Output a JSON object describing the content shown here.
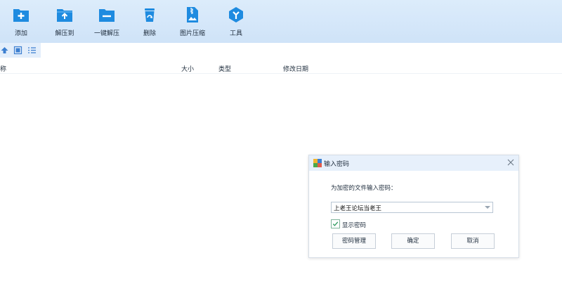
{
  "toolbar": {
    "items": [
      {
        "label": "添加",
        "icon": "add-folder-icon"
      },
      {
        "label": "解压到",
        "icon": "extract-to-icon"
      },
      {
        "label": "一键解压",
        "icon": "one-click-extract-icon"
      },
      {
        "label": "删除",
        "icon": "recycle-bin-icon"
      },
      {
        "label": "图片压缩",
        "icon": "image-compress-icon"
      },
      {
        "label": "工具",
        "icon": "tools-icon"
      }
    ]
  },
  "nav": {
    "icons": [
      "up-icon",
      "view-icon",
      "list-icon"
    ],
    "path": ""
  },
  "columns": {
    "name": "称",
    "size": "大小",
    "type": "类型",
    "modified": "修改日期"
  },
  "dialog": {
    "title": "输入密码",
    "prompt": "为加密的文件输入密码：",
    "password_value": "上老王论坛当老王",
    "show_password_label": "显示密码",
    "show_password_checked": true,
    "buttons": {
      "manage": "密码管理",
      "ok": "确定",
      "cancel": "取消"
    }
  },
  "colors": {
    "accent": "#1e8be0",
    "toolbar_bg": "#d6e8fa",
    "dialog_title_bg": "#e7f0fb",
    "checkbox_border": "#7fb39a"
  }
}
